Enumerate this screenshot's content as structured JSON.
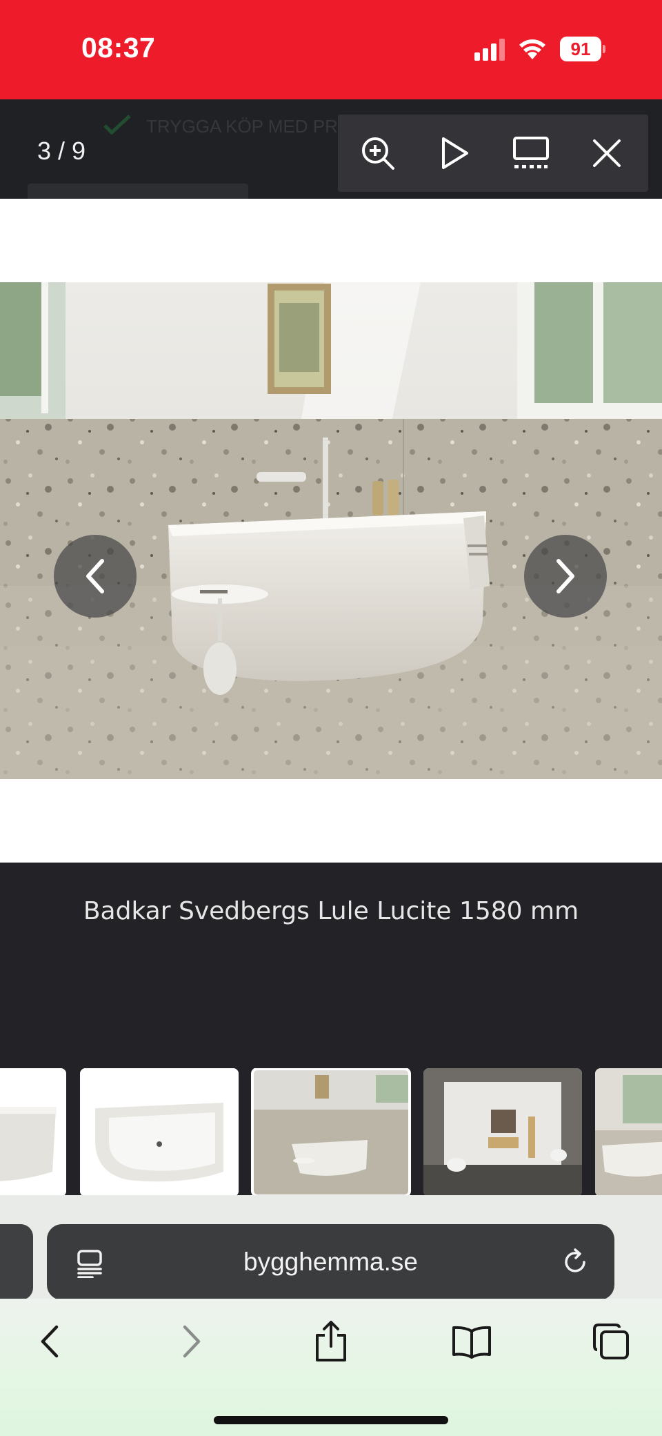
{
  "status_bar": {
    "time": "08:37",
    "battery": "91",
    "background_color": "#ee1c2b"
  },
  "gallery": {
    "counter": "3 / 9",
    "underlay_banner": "TRYGGA KÖP MED PR",
    "toolbar": {
      "zoom_icon": "zoom-in-icon",
      "play_icon": "play-icon",
      "thumbnails_icon": "thumbnails-icon",
      "close_icon": "close-icon"
    },
    "caption": "Badkar Svedbergs Lule Lucite 1580 mm",
    "thumbnail_count_visible": 5,
    "active_thumbnail_index": 2
  },
  "browser": {
    "url": "bygghemma.se",
    "icons": [
      "reader-icon",
      "reload-icon",
      "back-icon",
      "forward-icon",
      "share-icon",
      "bookmarks-icon",
      "tabs-icon"
    ]
  }
}
